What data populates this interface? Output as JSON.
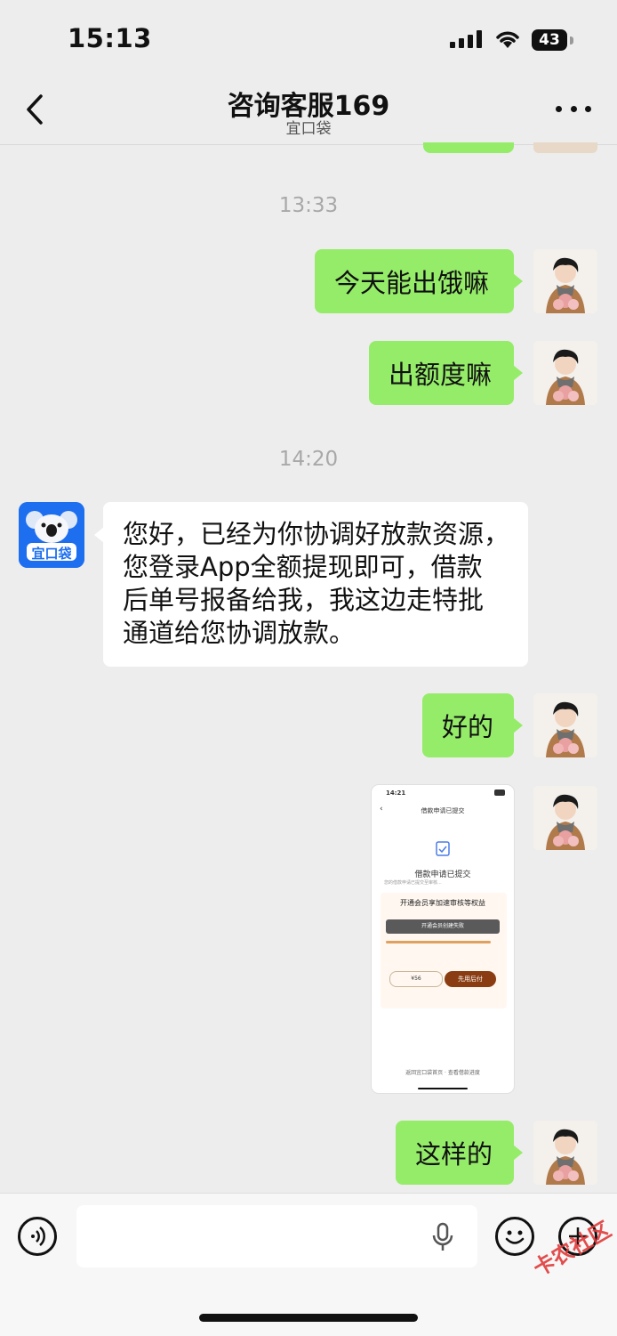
{
  "status_bar": {
    "time": "15:13",
    "battery": "43"
  },
  "header": {
    "title": "咨询客服169",
    "subtitle": "宜口袋"
  },
  "messages": {
    "ts1": "13:33",
    "m1": "今天能出饿嘛",
    "m2": "出额度嘛",
    "ts2": "14:20",
    "m3_lines": [
      "您好，已经为你协调好放款资源，",
      "您登录App全额提现即可，借款",
      "后单号报备给我，我这边走特批",
      "通道给您协调放款。"
    ],
    "m4": "好的",
    "m6": "这样的"
  },
  "brand_avatar": {
    "label": "宜口袋"
  },
  "screenshot_msg": {
    "time": "14:21",
    "title": "借款申请已提交",
    "heading": "借款申请已提交",
    "desc": "您的借款申请已提交至审核...",
    "member_title": "开通会员享加速审核等权益",
    "toast": "开通会员创建失败",
    "price": "¥56",
    "pay_btn": "先用后付",
    "footer": "返回宜口袋首页 · 查看借款进度"
  },
  "watermark": "卡农社区",
  "colors": {
    "bubble_green": "#95ec69",
    "bg": "#ededed",
    "brand_blue": "#1e6ff0"
  }
}
